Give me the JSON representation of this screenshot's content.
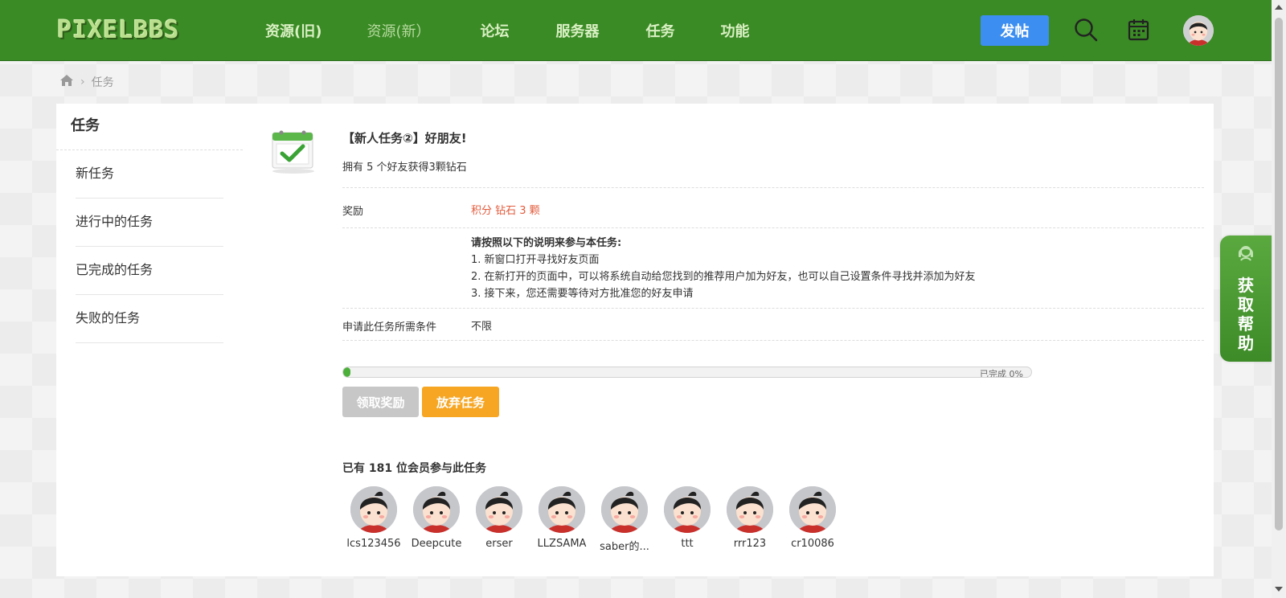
{
  "header": {
    "logo": "PIXELBBS",
    "nav": [
      {
        "label": "资源(旧)",
        "dim": false
      },
      {
        "label": "资源(新）",
        "dim": true
      },
      {
        "label": "论坛",
        "dim": false
      },
      {
        "label": "服务器",
        "dim": false
      },
      {
        "label": "任务",
        "dim": false
      },
      {
        "label": "功能",
        "dim": false
      }
    ],
    "post_button": "发帖"
  },
  "breadcrumb": {
    "current": "任务"
  },
  "sidebar": {
    "title": "任务",
    "items": [
      "新任务",
      "进行中的任务",
      "已完成的任务",
      "失败的任务"
    ]
  },
  "task": {
    "title": "【新人任务②】好朋友!",
    "description": "拥有 5 个好友获得3颗钻石",
    "reward_label": "奖励",
    "reward_value": "积分 钻石 3 颗",
    "instructions_head": "请按照以下的说明来参与本任务:",
    "instructions": [
      "1. 新窗口打开寻找好友页面",
      "2. 在新打开的页面中，可以将系统自动给您找到的推荐用户加为好友，也可以自己设置条件寻找并添加为好友",
      "3. 接下来，您还需要等待对方批准您的好友申请"
    ],
    "condition_label": "申请此任务所需条件",
    "condition_value": "不限",
    "progress_fraction": 0.01,
    "progress_text": "已完成 0%",
    "claim_button": "领取奖励",
    "abandon_button": "放弃任务",
    "participants_title": "已有 181 位会员参与此任务",
    "participants": [
      "lcs123456",
      "Deepcute",
      "erser",
      "LLZSAMA",
      "saber的...",
      "ttt",
      "rrr123",
      "cr10086"
    ]
  },
  "help_tab": "获取帮助"
}
